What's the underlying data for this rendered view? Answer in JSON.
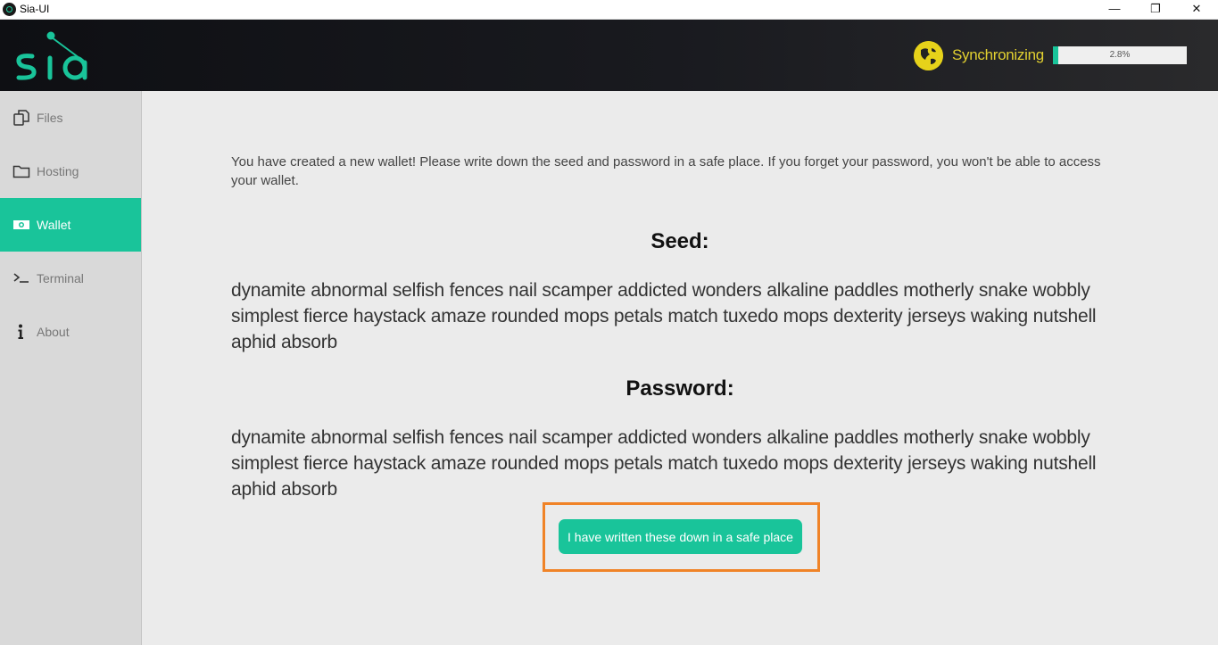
{
  "window": {
    "title": "Sia-UI",
    "minimize_glyph": "—",
    "maximize_glyph": "❐",
    "close_glyph": "✕"
  },
  "header": {
    "logo_icon": "sia-logo-icon",
    "sync_icon": "globe-icon",
    "sync_label": "Synchronizing",
    "sync_progress": 2.8,
    "sync_percent_text": "2.8%"
  },
  "colors": {
    "accent": "#19c49a",
    "sync_yellow": "#e2d030",
    "highlight_orange": "#f08327"
  },
  "sidebar": {
    "items": [
      {
        "label": "Files",
        "icon": "files-icon",
        "active": false
      },
      {
        "label": "Hosting",
        "icon": "folder-icon",
        "active": false
      },
      {
        "label": "Wallet",
        "icon": "wallet-icon",
        "active": true
      },
      {
        "label": "Terminal",
        "icon": "terminal-icon",
        "active": false
      },
      {
        "label": "About",
        "icon": "info-icon",
        "active": false
      }
    ]
  },
  "main": {
    "intro": "You have created a new wallet! Please write down the seed and password in a safe place. If you forget your password, you won't be able to access your wallet.",
    "seed_heading": "Seed:",
    "seed": "dynamite abnormal selfish fences nail scamper addicted wonders alkaline paddles motherly snake wobbly simplest fierce haystack amaze rounded mops petals match tuxedo mops dexterity jerseys waking nutshell aphid absorb",
    "password_heading": "Password:",
    "password": "dynamite abnormal selfish fences nail scamper addicted wonders alkaline paddles motherly snake wobbly simplest fierce haystack amaze rounded mops petals match tuxedo mops dexterity jerseys waking nutshell aphid absorb",
    "confirm_button": "I have written these down in a safe place"
  }
}
